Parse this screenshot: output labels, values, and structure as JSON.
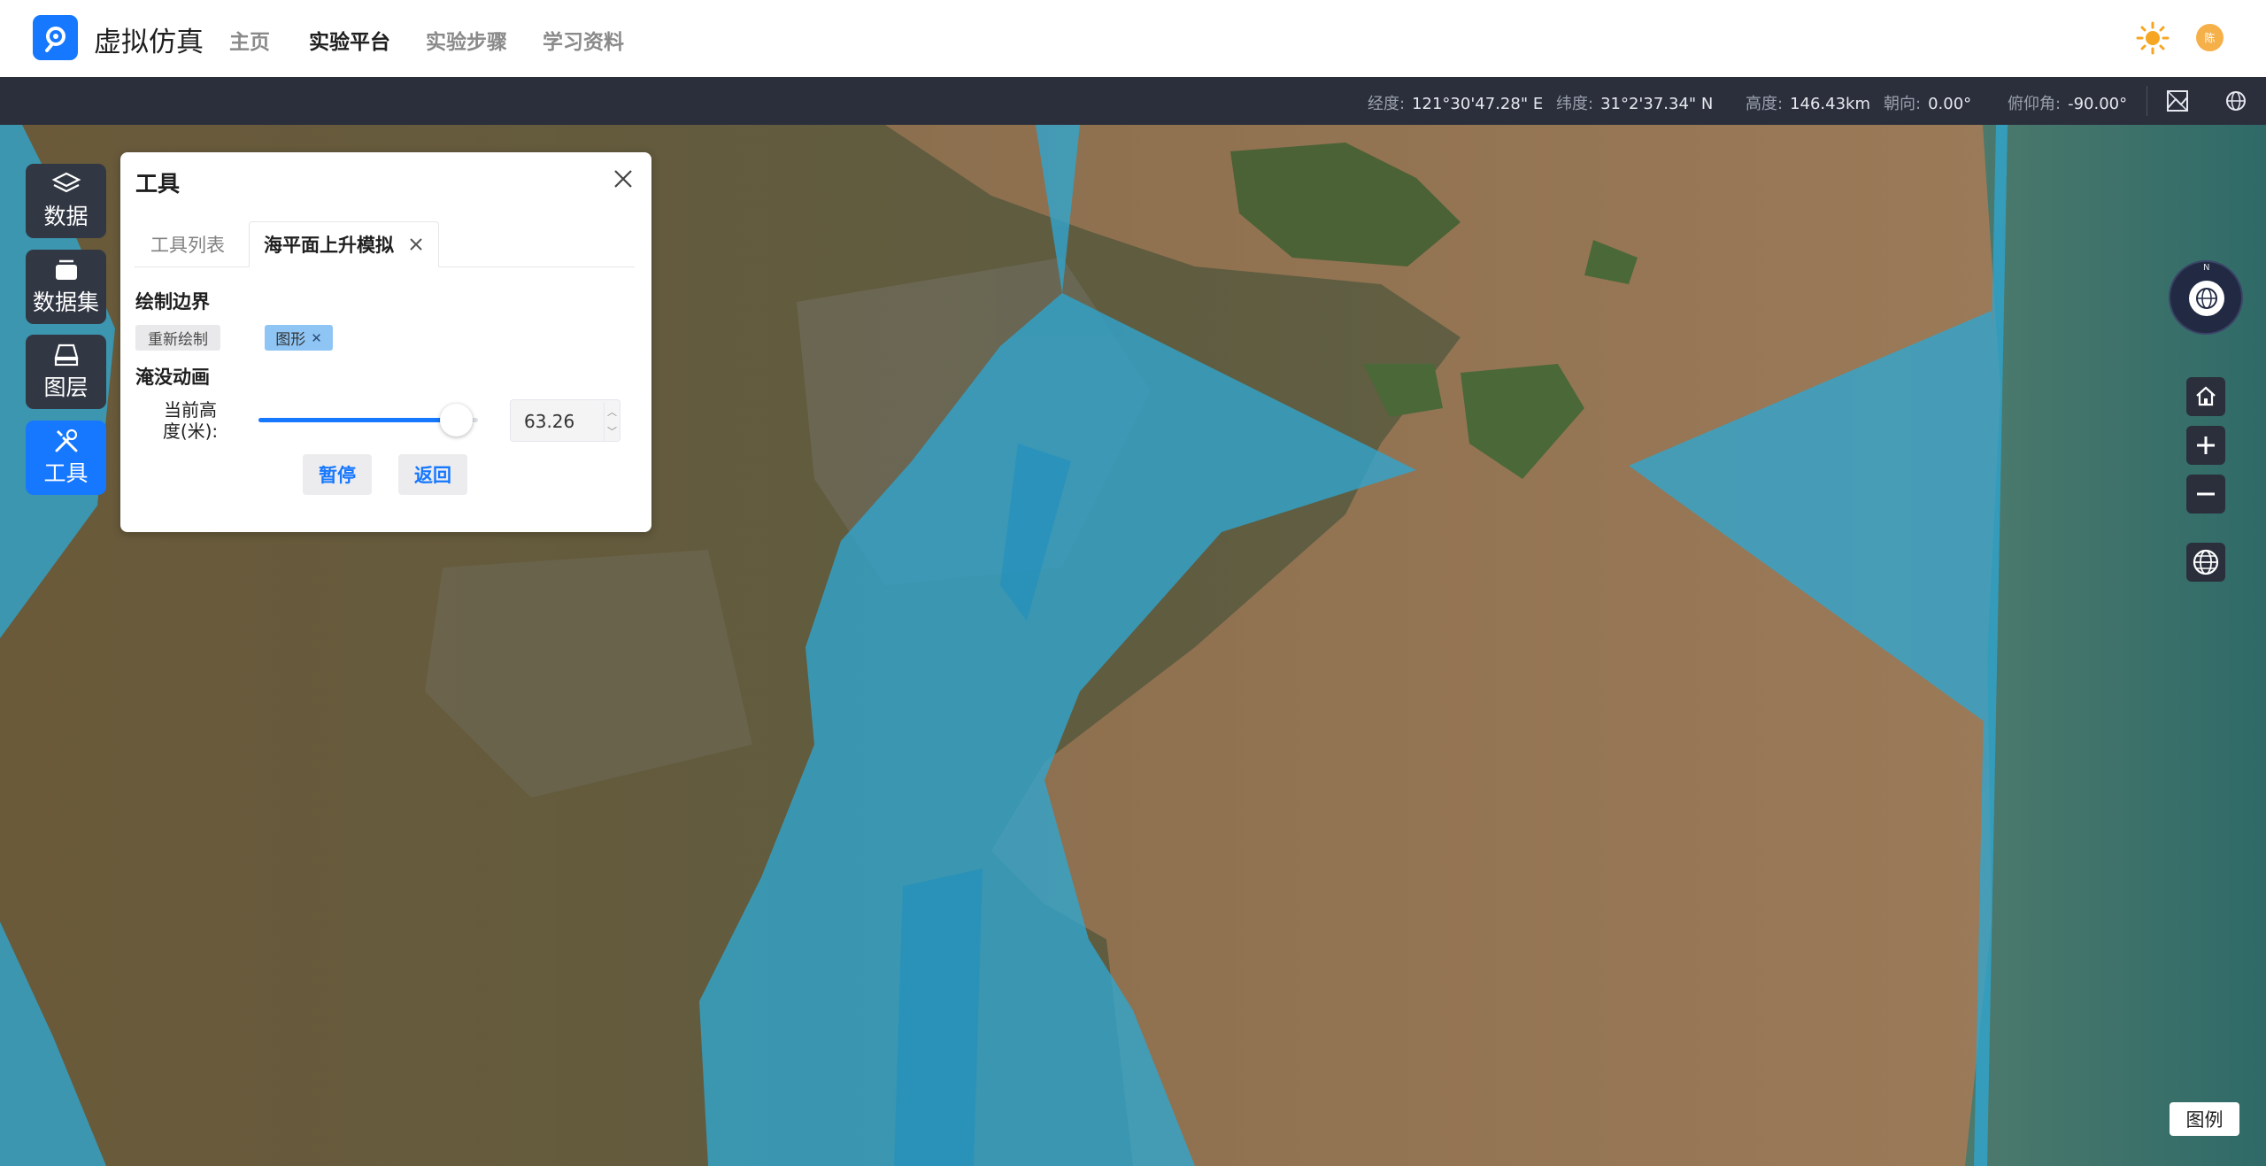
{
  "app": {
    "title": "虚拟仿真",
    "nav": [
      {
        "label": "主页",
        "active": false
      },
      {
        "label": "实验平台",
        "active": true
      },
      {
        "label": "实验步骤",
        "active": false
      },
      {
        "label": "学习资料",
        "active": false
      }
    ],
    "avatar_text": "陈"
  },
  "status": {
    "longitude_label": "经度:",
    "longitude": "121°30'47.28\" E",
    "latitude_label": "纬度:",
    "latitude": "31°2'37.34\" N",
    "altitude_label": "高度:",
    "altitude": "146.43km",
    "heading_label": "朝向:",
    "heading": "0.00°",
    "pitch_label": "俯仰角:",
    "pitch": "-90.00°"
  },
  "rail": [
    {
      "label": "数据",
      "icon": "layers-icon",
      "active": false
    },
    {
      "label": "数据集",
      "icon": "dataset-icon",
      "active": false
    },
    {
      "label": "图层",
      "icon": "layer-icon",
      "active": false
    },
    {
      "label": "工具",
      "icon": "tools-icon",
      "active": true
    }
  ],
  "panel": {
    "title": "工具",
    "tabs": [
      {
        "label": "工具列表",
        "active": false
      },
      {
        "label": "海平面上升模拟",
        "active": true
      }
    ],
    "draw_section": "绘制边界",
    "redraw_label": "重新绘制",
    "shape_tag": "图形",
    "animate_section": "淹没动画",
    "height_label": "当前高度(米):",
    "height_value": "63.26",
    "slider_fraction": 0.9,
    "pause_label": "暂停",
    "back_label": "返回"
  },
  "legend_label": "图例",
  "colors": {
    "accent": "#1677ff",
    "flood": "#2fa6d1",
    "statusbar": "#2b2f3c"
  }
}
